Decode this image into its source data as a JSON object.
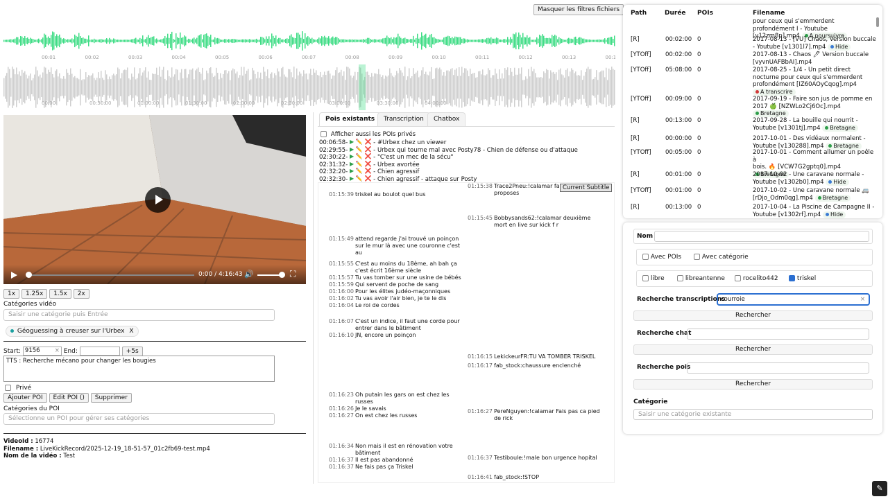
{
  "toolbar": {
    "hide_filters": "Masquer les filtres fichiers"
  },
  "waveform": {
    "top_ticks": [
      "00:01",
      "00:02",
      "00:03",
      "00:04",
      "00:05",
      "00:06",
      "00:07",
      "00:08",
      "00:09",
      "00:10",
      "00:11",
      "00:12",
      "00:13",
      "00:14"
    ],
    "bottom_ticks": [
      "00:00",
      "00:30:00",
      "01:00:00",
      "01:30:00",
      "02:00:00",
      "02:30:00",
      "03:00:00",
      "03:30:00",
      "04:00:00"
    ],
    "accent": "#3ddc84",
    "overview_color": "#cfcfcf"
  },
  "player": {
    "time": "0:00 / 4:16:43"
  },
  "speeds": [
    "1x",
    "1.25x",
    "1.5x",
    "2x"
  ],
  "video_categories": {
    "label": "Catégories vidéo",
    "placeholder": "Saisir une catégorie puis Entrée",
    "chip": "Géoguessing à creuser sur l'Urbex",
    "chip_remove": "X"
  },
  "poi_form": {
    "start_label": "Start:",
    "start_value": "9156",
    "clear": "×",
    "end_label": "End:",
    "end_value": "",
    "plus5": "+5s",
    "text": "TTS : Recherche mécano pour changer les bougies",
    "private": "Privé",
    "add": "Ajouter POI",
    "edit": "Edit POI ()",
    "delete": "Supprimer",
    "cat_label": "Catégories du POI",
    "cat_placeholder": "Sélectionne un POI pour gérer ses catégories"
  },
  "meta": {
    "id_label": "VideoId :",
    "id": "16774",
    "file_label": "Filename :",
    "file": "LiveKickRecord/2025-12-19_18-51-57_01c2fb69-test.mp4",
    "name_label": "Nom de la vidéo :",
    "name": "Test"
  },
  "tabs": [
    "Pois existants",
    "Transcription",
    "Chatbox"
  ],
  "pois": {
    "private_toggle": "Afficher aussi les POIs privés",
    "items": [
      {
        "time": "00:06:58",
        "text": "#Urbex chez un viewer"
      },
      {
        "time": "02:29:55",
        "text": "Urbex qui tourne mal avec Posty78 - Chien de défense ou d'attaque"
      },
      {
        "time": "02:30:22",
        "text": "\"C'est un mec de la sécu\""
      },
      {
        "time": "02:31:32",
        "text": "Urbex avortée"
      },
      {
        "time": "02:32:20",
        "text": "Chien agressif"
      },
      {
        "time": "02:32:30",
        "text": "Chien agressif - attaque sur Posty"
      }
    ]
  },
  "current_subtitle": "Current Subtitle",
  "transcript": [
    {
      "t": "01:15:39",
      "x": "triskel au boulot quel bus"
    },
    {
      "t": "01:15:49",
      "x": "attend regarde j'ai trouvé un poinçon"
    },
    {
      "t": "",
      "x": "sur le mur là avec une couronne c'est"
    },
    {
      "t": "",
      "x": "au"
    },
    {
      "t": "01:15:55",
      "x": "C'est au moins du 18ème, ah bah ça"
    },
    {
      "t": "",
      "x": "c'est écrit 16ème siècle"
    },
    {
      "t": "01:15:57",
      "x": "Tu vas tomber sur une usine de bébés"
    },
    {
      "t": "01:15:59",
      "x": "Qui servent de poche de sang"
    },
    {
      "t": "01:16:00",
      "x": "Pour les élites judéo-maçonniques"
    },
    {
      "t": "01:16:02",
      "x": "Tu vas avoir l'air bien, je te le dis"
    },
    {
      "t": "01:16:04",
      "x": "Le roi de cordes"
    },
    {
      "t": "01:16:07",
      "x": "C'est un indice, il faut une corde pour"
    },
    {
      "t": "",
      "x": "entrer dans le bâtiment"
    },
    {
      "t": "01:16:10",
      "x": "JN, encore un poinçon"
    },
    {
      "t": "01:16:23",
      "x": "Oh putain les gars on est chez les"
    },
    {
      "t": "",
      "x": "russes"
    },
    {
      "t": "01:16:26",
      "x": "Je le savais"
    },
    {
      "t": "01:16:27",
      "x": "On est chez les russes"
    },
    {
      "t": "01:16:34",
      "x": "Non mais il est en rénovation votre"
    },
    {
      "t": "",
      "x": "bâtiment"
    },
    {
      "t": "01:16:37",
      "x": "Il est pas abandonné"
    },
    {
      "t": "01:16:37",
      "x": "Ne fais pas ça Triskel"
    }
  ],
  "chat": [
    {
      "t": "01:15:38",
      "x": "Trace2Pneu:!calamar fais"
    },
    {
      "t": "",
      "x": "proposes"
    },
    {
      "t": "01:15:45",
      "x": "Bobbysands62:!calamar deuxième"
    },
    {
      "t": "",
      "x": "mort en live sur kick f r"
    },
    {
      "t": "01:16:15",
      "x": "LekickeurFR:TU VA TOMBER TRISKEL"
    },
    {
      "t": "01:16:17",
      "x": "fab_stock:chaussure enclenché"
    },
    {
      "t": "01:16:27",
      "x": "PereNguyen:!calamar Fais pas ca pied"
    },
    {
      "t": "",
      "x": "de rick"
    },
    {
      "t": "01:16:37",
      "x": "Testiboule:!male bon urgence hopital"
    },
    {
      "t": "01:16:41",
      "x": "fab_stock:!STOP"
    }
  ],
  "files": {
    "headers": [
      "Path",
      "Durée",
      "POIs",
      "Filename"
    ],
    "rows": [
      {
        "path": "",
        "dur": "",
        "pois": "",
        "name": [
          "pour ceux qui s'emmerdent",
          "profondément I - Youtube",
          "[v12zm8p].mp4"
        ],
        "tag": "A poursuivre",
        "tagcolor": "#2e9e4a"
      },
      {
        "path": "[R]",
        "dur": "00:02:00",
        "pois": "0",
        "name": [
          "2017-08-13 - [VU] Chaos, Version buccale",
          "- Youtube [v1301l7].mp4"
        ],
        "tag": "Hide",
        "tagcolor": "#3b7bd4"
      },
      {
        "path": "[YTOff]",
        "dur": "00:02:00",
        "pois": "0",
        "name": [
          "2017-08-13 - Chaos 🖊 Version buccale",
          "[vyvnUAFBbAI].mp4"
        ],
        "tag": "",
        "tagcolor": ""
      },
      {
        "path": "[YTOff]",
        "dur": "05:08:00",
        "pois": "0",
        "name": [
          "2017-08-25 - 1/4 - Un petit direct",
          "nocturne pour ceux qui s'emmerdent",
          "profondément [IZ60AOyCqog].mp4"
        ],
        "tag": "A transcrire",
        "tagcolor": "#d23a3a"
      },
      {
        "path": "[YTOff]",
        "dur": "00:09:00",
        "pois": "0",
        "name": [
          "2017-09-19 - Faire son jus de pomme en",
          "2017 🍏 [NZWLo2Cj6Oc].mp4"
        ],
        "tag": "Bretagne",
        "tagcolor": "#2e9e4a"
      },
      {
        "path": "[R]",
        "dur": "00:13:00",
        "pois": "0",
        "name": [
          "2017-09-28 - La bouille qui nourrit -",
          "Youtube [v1301tj].mp4"
        ],
        "tag": "Bretagne",
        "tagcolor": "#2e9e4a"
      },
      {
        "path": "[R]",
        "dur": "00:00:00",
        "pois": "0",
        "name": [
          "2017-10-01 - Des vidéaux normalent -",
          "Youtube [v130288].mp4"
        ],
        "tag": "Bretagne",
        "tagcolor": "#2e9e4a"
      },
      {
        "path": "[YTOff]",
        "dur": "00:05:00",
        "pois": "0",
        "name": [
          "2017-10-01 - Comment allumer un poêle à",
          "bois. 🔥 [VCW7G2gptq0].mp4"
        ],
        "tag": "Bretagne",
        "tagcolor": "#2e9e4a"
      },
      {
        "path": "[R]",
        "dur": "00:01:00",
        "pois": "0",
        "name": [
          "2017-10-02 - Une caravane normale -",
          "Youtube [v1302b0].mp4"
        ],
        "tag": "Hide",
        "tagcolor": "#3b7bd4"
      },
      {
        "path": "[YTOff]",
        "dur": "00:01:00",
        "pois": "0",
        "name": [
          "2017-10-02 - Une caravane normale 🚐",
          "[rDjo_Odm0qg].mp4"
        ],
        "tag": "Bretagne",
        "tagcolor": "#2e9e4a"
      },
      {
        "path": "[R]",
        "dur": "00:13:00",
        "pois": "0",
        "name": [
          "2017-10-04 - La Piscine de Campagne II -",
          "Youtube [v1302rf].mp4"
        ],
        "tag": "Hide",
        "tagcolor": "#3b7bd4"
      }
    ]
  },
  "filters": {
    "name_label": "Nom",
    "avec_pois": "Avec POIs",
    "avec_cat": "Avec catégorie",
    "sources": [
      {
        "label": "libre",
        "on": false
      },
      {
        "label": "libreantenne",
        "on": false
      },
      {
        "label": "rocelito442",
        "on": false
      },
      {
        "label": "triskel",
        "on": true
      }
    ],
    "transcript_label": "Recherche transcriptions",
    "transcript_value": "courroie",
    "search": "Rechercher",
    "chat_label": "Recherche chat",
    "pois_label": "Recherche pois",
    "cat_label": "Catégorie",
    "cat_placeholder": "Saisir une catégorie existante"
  }
}
